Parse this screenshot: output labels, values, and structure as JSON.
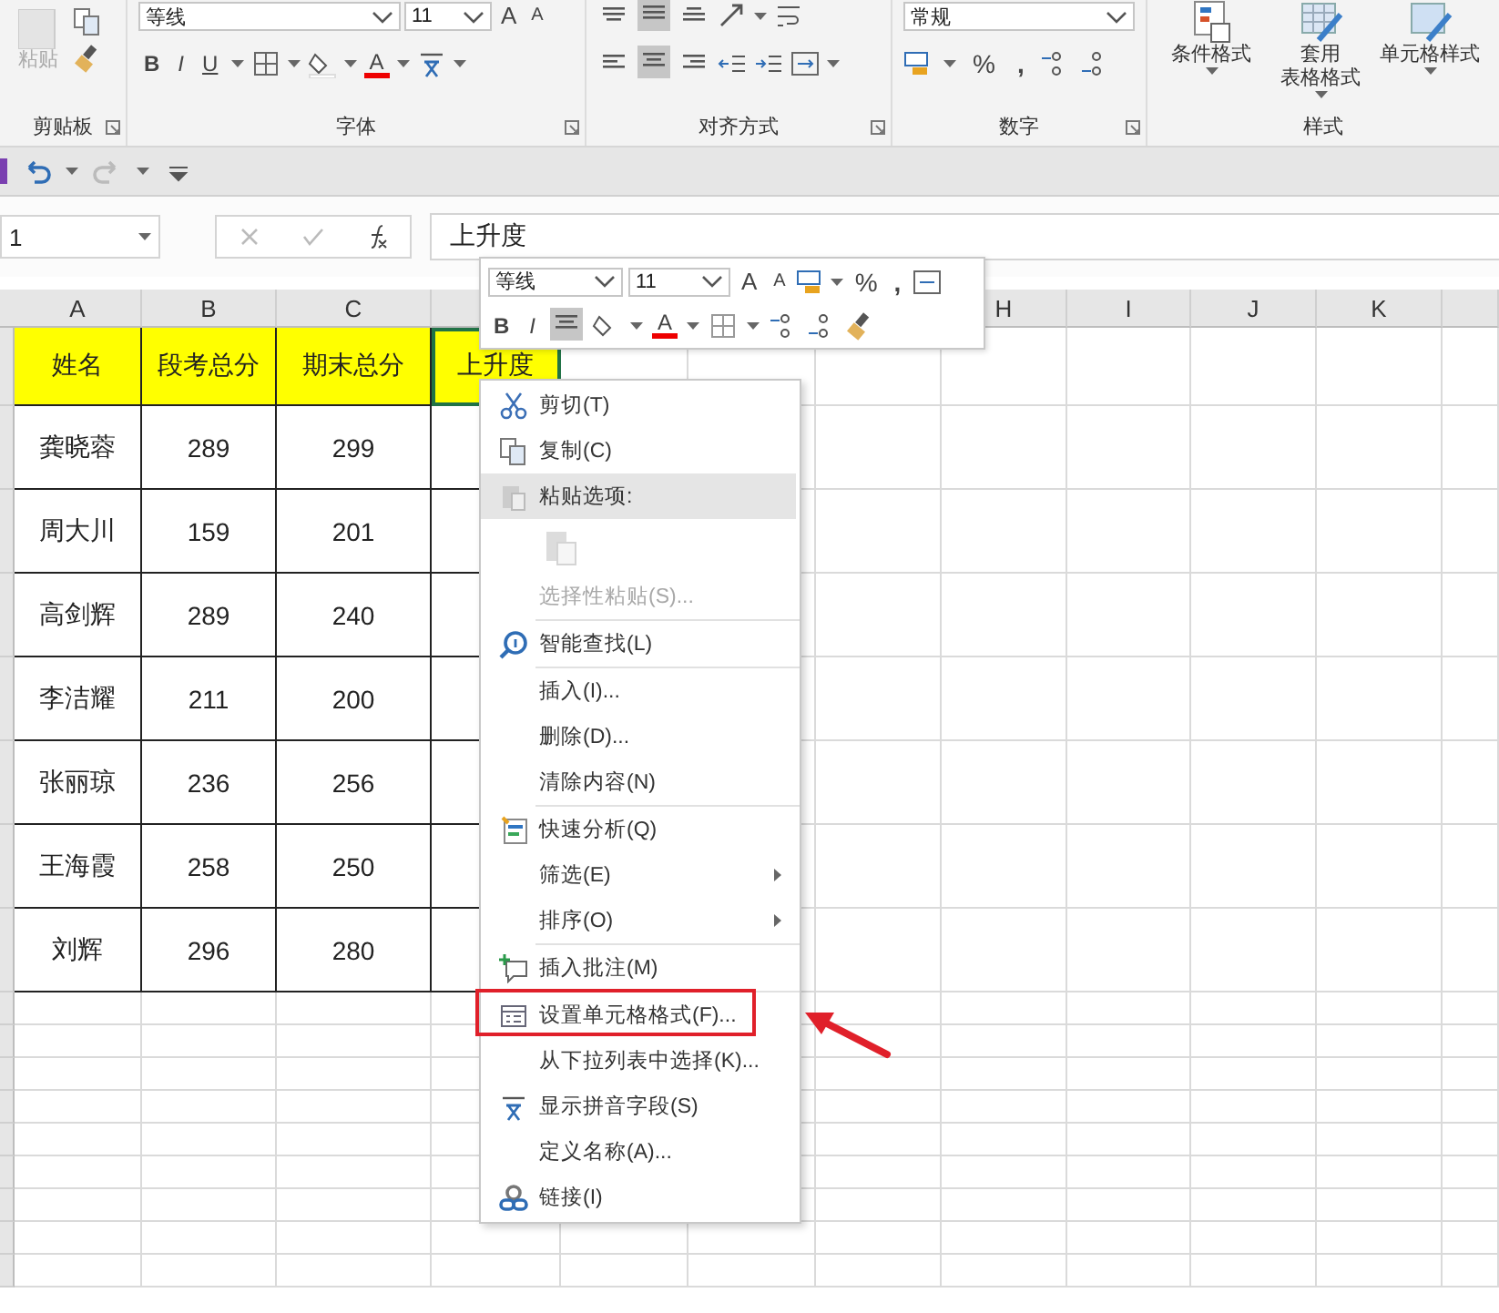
{
  "ribbon": {
    "clipboard": {
      "paste_label": "粘贴",
      "label": "剪贴板"
    },
    "font": {
      "font_name": "等线",
      "font_size": "11",
      "grow": "A",
      "shrink": "A",
      "bold": "B",
      "italic": "I",
      "underline": "U",
      "font_color": "A",
      "label": "字体"
    },
    "alignment": {
      "middle_selected": true,
      "center_selected": true,
      "label": "对齐方式"
    },
    "number": {
      "format": "常规",
      "percent": "%",
      "comma": ",",
      "label": "数字"
    },
    "styles": {
      "buttons": [
        {
          "lines": [
            "条件格式"
          ],
          "kind": "conditional"
        },
        {
          "lines": [
            "套用",
            "表格格式"
          ],
          "kind": "table"
        },
        {
          "lines": [
            "单元格样式"
          ],
          "kind": "cellstyle"
        }
      ],
      "label": "样式"
    }
  },
  "formula_bar": {
    "name_box": "1",
    "content": "上升度"
  },
  "columns_left": [
    "A",
    "B",
    "C"
  ],
  "columns_right": [
    "H",
    "I",
    "J",
    "K"
  ],
  "table": {
    "header": [
      {
        "text": "姓名",
        "selected": false
      },
      {
        "text": "段考总分",
        "selected": false
      },
      {
        "text": "期末总分",
        "selected": false
      },
      {
        "text": "上升度",
        "selected": true
      }
    ],
    "rows": [
      [
        "龚晓蓉",
        "289",
        "299"
      ],
      [
        "周大川",
        "159",
        "201"
      ],
      [
        "高剑辉",
        "289",
        "240"
      ],
      [
        "李洁耀",
        "211",
        "200"
      ],
      [
        "张丽琼",
        "236",
        "256"
      ],
      [
        "王海霞",
        "258",
        "250"
      ],
      [
        "刘辉",
        "296",
        "280"
      ]
    ]
  },
  "mini_toolbar": {
    "font_name": "等线",
    "font_size": "11",
    "grow": "A",
    "shrink": "A",
    "percent": "%",
    "comma": ",",
    "bold": "B",
    "italic": "I",
    "font_color": "A",
    "center_selected": true
  },
  "context_menu": {
    "sections": [
      [
        {
          "label": "剪切(T)",
          "kind": "cut",
          "disabled": false,
          "hovered": false,
          "submenu": false,
          "marked": false
        },
        {
          "label": "复制(C)",
          "kind": "copy",
          "disabled": false,
          "hovered": false,
          "submenu": false,
          "marked": false
        },
        {
          "label": "粘贴选项:",
          "kind": "paste-heading",
          "disabled": false,
          "hovered": true,
          "submenu": false,
          "marked": false
        },
        {
          "kind": "paste-option",
          "disabled": true,
          "hovered": false,
          "submenu": false,
          "marked": false
        },
        {
          "label": "选择性粘贴(S)...",
          "kind": "plain",
          "disabled": true,
          "hovered": false,
          "submenu": false,
          "marked": false
        }
      ],
      [
        {
          "label": "智能查找(L)",
          "kind": "lookup",
          "disabled": false,
          "hovered": false,
          "submenu": false,
          "marked": false
        }
      ],
      [
        {
          "label": "插入(I)...",
          "kind": "plain",
          "disabled": false,
          "hovered": false,
          "submenu": false,
          "marked": false
        },
        {
          "label": "删除(D)...",
          "kind": "plain",
          "disabled": false,
          "hovered": false,
          "submenu": false,
          "marked": false
        },
        {
          "label": "清除内容(N)",
          "kind": "plain",
          "disabled": false,
          "hovered": false,
          "submenu": false,
          "marked": false
        }
      ],
      [
        {
          "label": "快速分析(Q)",
          "kind": "analysis",
          "disabled": false,
          "hovered": false,
          "submenu": false,
          "marked": false
        },
        {
          "label": "筛选(E)",
          "kind": "plain",
          "disabled": false,
          "hovered": false,
          "submenu": true,
          "marked": false
        },
        {
          "label": "排序(O)",
          "kind": "plain",
          "disabled": false,
          "hovered": false,
          "submenu": true,
          "marked": false
        }
      ],
      [
        {
          "label": "插入批注(M)",
          "kind": "comment",
          "disabled": false,
          "hovered": false,
          "submenu": false,
          "marked": false
        }
      ],
      [
        {
          "label": "设置单元格格式(F)...",
          "kind": "format",
          "disabled": false,
          "hovered": false,
          "submenu": false,
          "marked": true
        },
        {
          "label": "从下拉列表中选择(K)...",
          "kind": "plain",
          "disabled": false,
          "hovered": false,
          "submenu": false,
          "marked": false
        },
        {
          "label": "显示拼音字段(S)",
          "kind": "phonetic",
          "disabled": false,
          "hovered": false,
          "submenu": false,
          "marked": false
        },
        {
          "label": "定义名称(A)...",
          "kind": "plain",
          "disabled": false,
          "hovered": false,
          "submenu": false,
          "marked": false
        },
        {
          "label": "链接(I)",
          "kind": "link",
          "disabled": false,
          "hovered": false,
          "submenu": false,
          "marked": false
        }
      ]
    ]
  }
}
